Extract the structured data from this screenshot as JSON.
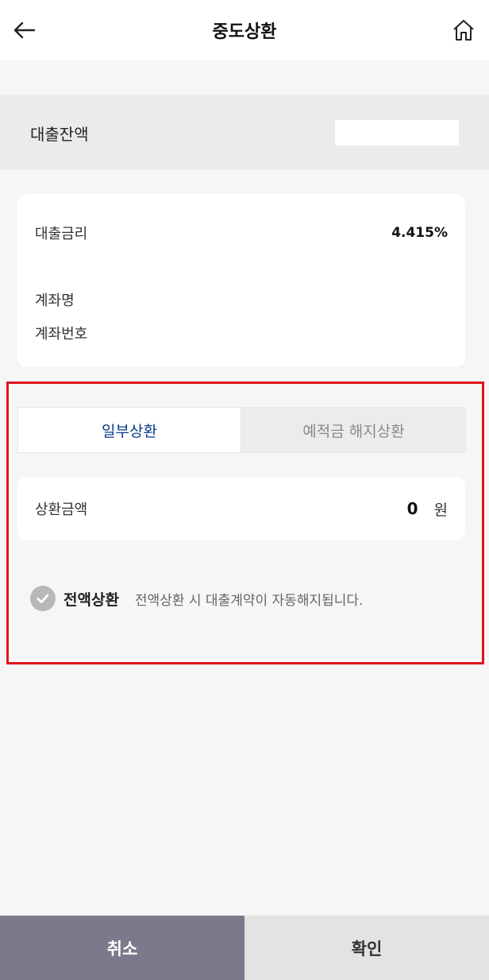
{
  "header": {
    "title": "중도상환"
  },
  "balance": {
    "label": "대출잔액"
  },
  "info": {
    "rate_label": "대출금리",
    "rate_value": "4.415%",
    "account_name_label": "계좌명",
    "account_number_label": "계좌번호"
  },
  "tabs": [
    {
      "label": "일부상환",
      "active": true
    },
    {
      "label": "예적금 해지상환",
      "active": false
    }
  ],
  "amount": {
    "label": "상환금액",
    "value": "0",
    "unit": "원"
  },
  "full_repay": {
    "label": "전액상환",
    "description": "전액상환 시 대출계약이 자동해지됩니다."
  },
  "footer": {
    "cancel": "취소",
    "confirm": "확인"
  },
  "colors": {
    "highlight": "#e0141e",
    "active_tab_text": "#0a3c8c",
    "cancel_button": "#7c7a8a",
    "confirm_button": "#e3e3e3"
  }
}
